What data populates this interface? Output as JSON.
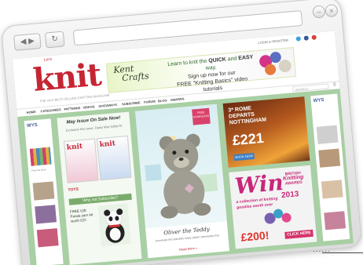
{
  "site": {
    "logo_small": "Let's",
    "logo": "knit",
    "tagline": "THE UK'S BEST-SELLING KNITTING MAGAZINE",
    "top_links": "LOGIN or REGISTER"
  },
  "banner": {
    "brand_line1": "Kent",
    "brand_line2": "Crafts",
    "line1_pre": "Learn to knit the ",
    "line1_bold": "QUICK",
    "line1_mid": " and ",
    "line1_bold2": "EASY",
    "line1_post": " way.",
    "line2": "Sign up now for our",
    "line3": "FREE \"Knitting Basics\" video tutorials"
  },
  "menu": [
    "HOME",
    "CATEGORIES",
    "PATTERNS",
    "VIDEOS",
    "GIVEAWAYS",
    "SUBSCRIBE",
    "FORUM",
    "BLOG",
    "AWARDS"
  ],
  "search": {
    "placeholder": "SEARCH"
  },
  "left_ad": {
    "brand": "WYS",
    "caption": "Find out more"
  },
  "right_ad": {
    "brand": "WYS"
  },
  "issue": {
    "title": "May Issue On Sale Now!",
    "sub": "Exclusive this issue: Daisy May teddy kit",
    "mag1": "knit",
    "mag2": "knit",
    "subscribe_bar": "Why not Subscribe?",
    "free_text": "FREE Gift: Panda yarn kit worth £22",
    "footer": "TOYS"
  },
  "teddy": {
    "badge": "FREE DOWNLOAD",
    "title": "Oliver the Teddy",
    "desc": "Download this adorable teddy pattern absolutely free",
    "read_more": "Read More »"
  },
  "rome": {
    "line1": "3* ROME",
    "line2": "DEPARTS",
    "line3": "NOTTINGHAM",
    "price": "£221",
    "button": "BOOK NOW"
  },
  "win_ad": {
    "big": "Win",
    "sub": "a collection of knitting goodies worth over",
    "awards_line1": "BRITISH",
    "awards_line2": "Knitting",
    "awards_line3": "AWARDS",
    "year": "2013",
    "prize": "£200!",
    "button": "CLICK HERE"
  },
  "trailing_dots": "......"
}
